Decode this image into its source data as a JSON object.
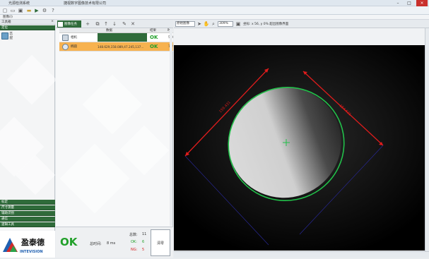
{
  "window": {
    "title": "光源检测系统",
    "company": "捷视数字图像技术有限公司"
  },
  "menubar": {
    "label": "图像(I)"
  },
  "left_panel": {
    "title": "工具箱",
    "close_label": "×",
    "section_header": "定位",
    "item_label": "匹配",
    "bottom_sections": [
      "标定",
      "尺寸测量",
      "辅助识别",
      "通信",
      "逻辑工具"
    ]
  },
  "mid_panel": {
    "tab_label": "图像任务",
    "table": {
      "columns": [
        "",
        "数据",
        "结果",
        "时"
      ],
      "rows": [
        {
          "name": "相机",
          "data": "",
          "result": "OK",
          "time": "5.0"
        },
        {
          "name": "椭圆",
          "data": "148.629,158.089,47.245,137...",
          "result": "OK",
          "time": "7.2",
          "selected": true
        }
      ]
    },
    "summary": {
      "status": "OK",
      "total_time_label": "总时间:",
      "total_time_value": "8 ms",
      "total_count_label": "总数:",
      "total_count": "11",
      "ok_label": "OK:",
      "ok_count": "6",
      "ng_label": "NG:",
      "ng_count": "5",
      "reset_label": "清零"
    }
  },
  "viewer": {
    "image_select": "原始图像",
    "zoom": "309%",
    "coords_text": "坐标: x 56, y 0% 超出图像界面",
    "measure_left": "159.431",
    "measure_right": "154.621"
  },
  "brand": {
    "cn_name": "盈泰德",
    "en_name": "INTEVISION"
  },
  "colors": {
    "accent_green": "#2f6b3a",
    "ok_green": "#22a02a",
    "ng_red": "#d32020",
    "selection_orange": "#f7b24f",
    "measure_red": "#e01c1c",
    "ellipse_green": "#22c04a"
  }
}
